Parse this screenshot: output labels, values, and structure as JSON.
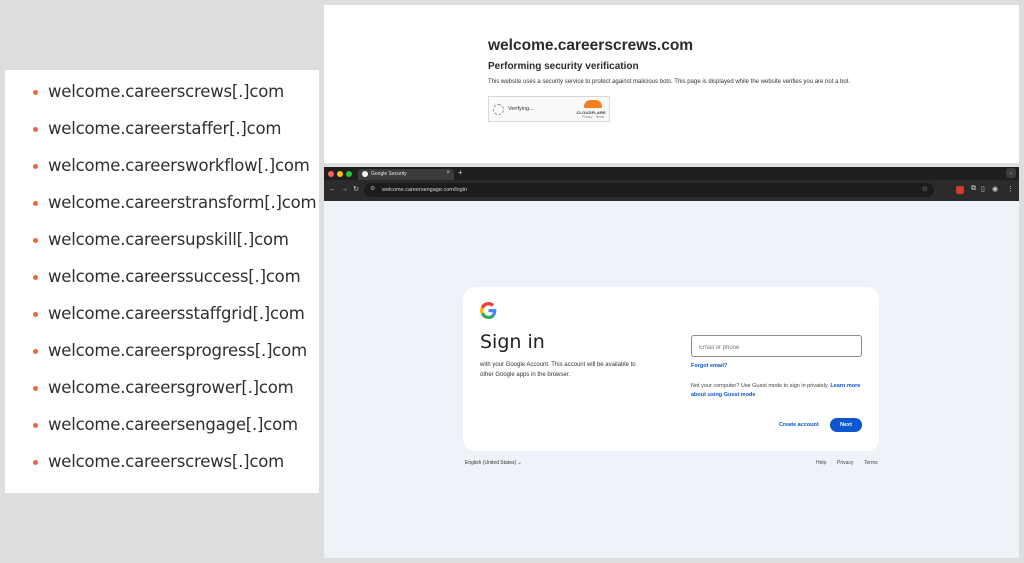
{
  "domain_list": [
    "welcome.careerscrews[.]com",
    "welcome.careerstaffer[.]com",
    "welcome.careersworkflow[.]com",
    "welcome.careerstransform[.]com",
    "welcome.careersupskill[.]com",
    "welcome.careerssuccess[.]com",
    "welcome.careersstaffgrid[.]com",
    "welcome.careersprogress[.]com",
    "welcome.careersgrower[.]com",
    "welcome.careersengage[.]com",
    "welcome.careerscrews[.]com"
  ],
  "verification": {
    "domain": "welcome.careerscrews.com",
    "title": "Performing security verification",
    "description": "This website uses a security service to protect against malicious bots. This page is displayed while the website verifies you are not a bot.",
    "widget_status": "Verifying...",
    "provider": "CLOUDFLARE",
    "provider_links": "Privacy · Terms",
    "accent_color": "#f38020"
  },
  "browser": {
    "tab_title": "Google Security",
    "url": "welcome.careersengage.com/login"
  },
  "signin": {
    "title": "Sign in",
    "subtitle": "with your Google Account. This account will be available to other Google apps in the browser.",
    "email_placeholder": "Email or phone",
    "forgot_email": "Forgot email?",
    "guest_note": "Not your computer? Use Guest mode to sign in privately.",
    "guest_link": "Learn more about using Guest mode",
    "create_account": "Create account",
    "next": "Next",
    "primary_color": "#0b57d0"
  },
  "footer": {
    "language": "English (United States) ⌄",
    "help": "Help",
    "privacy": "Privacy",
    "terms": "Terms"
  }
}
